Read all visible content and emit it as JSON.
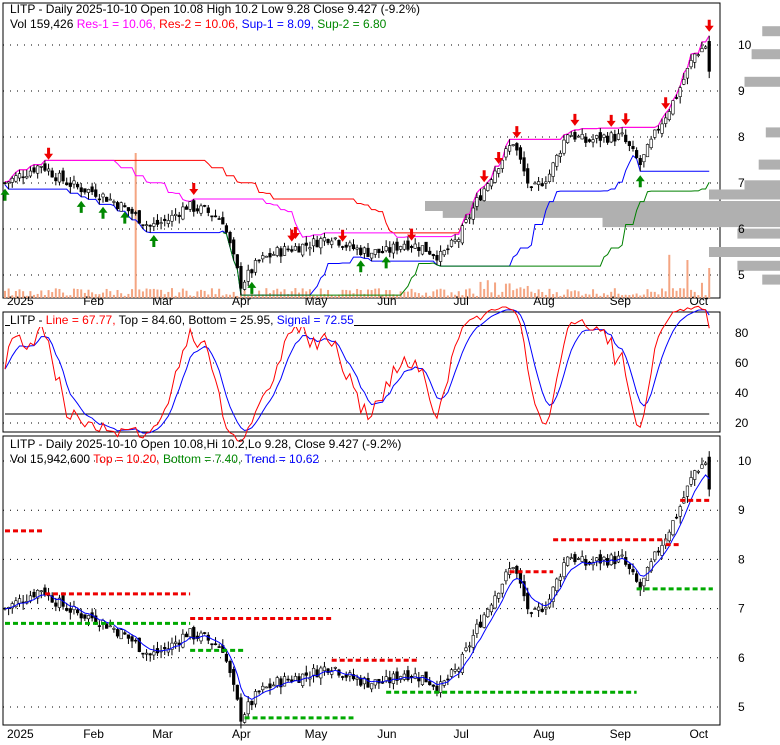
{
  "header1": {
    "line1": "LITP - Daily 2025-10-10 Open 10.08  High 10.2  Low 9.28  Close 9.427 (-9.2%)",
    "vol": "Vol 159,426",
    "res1": "Res-1 = 10.06,",
    "res2": "Res-2 = 10.06,",
    "sup1": "Sup-1 = 8.09,",
    "sup2": "Sup-2 = 6.80"
  },
  "header2": {
    "name": "LITP - ",
    "line": "Line = 67.77,",
    "top": "Top = 84.60,",
    "bottom": "Bottom = 25.95,",
    "signal": "Signal = 72.55"
  },
  "header3": {
    "line1": "LITP - Daily 2025-10-10 Open 10.08,Hi 10.2,Lo 9.28, Close 9.427 (-9.2%)",
    "vol": "Vol 15,942,600",
    "top": "Top = 10.20,",
    "bottom": "Bottom = 7.40,",
    "trend": "Trend = 10.62"
  },
  "colors": {
    "res1": "#ff00ff",
    "res2": "#ff0000",
    "sup1": "#0000ff",
    "sup2": "#008000",
    "volume": "#f4a582",
    "profile": "#b0b0b0"
  },
  "chart_data": {
    "type": "candlestick",
    "months": [
      "2025",
      "Feb",
      "Mar",
      "Apr",
      "May",
      "Jun",
      "Jul",
      "Aug",
      "Sep",
      "Oct"
    ],
    "month_start_days": [
      0,
      21,
      40,
      62,
      82,
      102,
      123,
      145,
      166,
      188
    ],
    "price_axis_1": [
      "10",
      "9",
      "8",
      "7",
      "6",
      "5"
    ],
    "price_axis_3": [
      "10",
      "9",
      "8",
      "7",
      "6",
      "5"
    ],
    "osc_axis": [
      "80",
      "60",
      "40",
      "20"
    ],
    "weekly_closes": [
      7.0,
      7.2,
      7.4,
      7.1,
      6.9,
      6.8,
      6.6,
      6.35,
      6.05,
      6.2,
      6.5,
      6.4,
      6.2,
      4.8,
      5.3,
      5.5,
      5.6,
      5.7,
      5.85,
      5.6,
      5.5,
      5.5,
      5.7,
      5.6,
      5.4,
      5.8,
      6.6,
      7.3,
      7.9,
      6.8,
      7.2,
      8.1,
      7.9,
      8.0,
      8.0,
      7.4,
      8.2,
      8.9,
      9.8,
      10.1
    ],
    "last": {
      "open": 10.08,
      "high": 10.2,
      "low": 9.28,
      "close": 9.427
    },
    "sell_signal_days": [
      12,
      52,
      79,
      80,
      93,
      112,
      132,
      136,
      141,
      157,
      167,
      171,
      182,
      194
    ],
    "buy_signal_days": [
      0,
      21,
      27,
      33,
      41,
      68,
      98,
      105,
      175
    ],
    "top_segments": [
      [
        8.58,
        0,
        11
      ],
      [
        7.3,
        11,
        51
      ],
      [
        6.8,
        51,
        90
      ],
      [
        5.95,
        90,
        114
      ],
      [
        7.75,
        139,
        151
      ],
      [
        8.4,
        151,
        182
      ],
      [
        8.3,
        182,
        186
      ],
      [
        9.2,
        186,
        194
      ]
    ],
    "bottom_segments": [
      [
        6.7,
        0,
        51
      ],
      [
        6.15,
        51,
        66
      ],
      [
        4.78,
        66,
        96
      ],
      [
        5.3,
        105,
        174
      ],
      [
        7.4,
        174,
        195
      ]
    ],
    "volume_profile": [
      [
        10.3,
        0.05
      ],
      [
        9.8,
        0.08
      ],
      [
        9.2,
        0.1
      ],
      [
        8.1,
        0.04
      ],
      [
        7.4,
        0.06
      ],
      [
        6.95,
        0.1
      ],
      [
        6.75,
        0.2
      ],
      [
        6.5,
        1.0
      ],
      [
        6.35,
        0.95
      ],
      [
        6.15,
        0.5
      ],
      [
        5.9,
        0.12
      ],
      [
        5.5,
        0.2
      ],
      [
        5.2,
        0.12
      ],
      [
        4.9,
        0.05
      ]
    ]
  }
}
